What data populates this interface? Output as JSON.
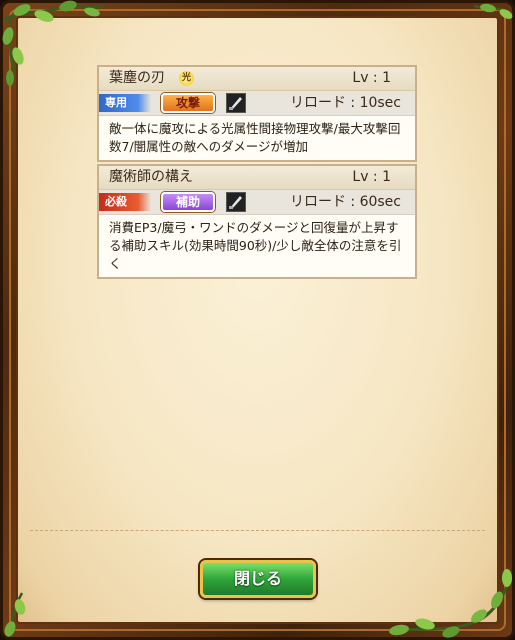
{
  "skills": [
    {
      "name": "葉塵の刃",
      "element_badge": "光",
      "level": "Lv : 1",
      "type_tag": "専用",
      "category": "攻撃",
      "reload": "リロード : 10sec",
      "description": "敵一体に魔攻による光属性間接物理攻撃/最大攻撃回数7/闇属性の敵へのダメージが増加"
    },
    {
      "name": "魔術師の構え",
      "level": "Lv : 1",
      "type_tag": "必殺",
      "category": "補助",
      "reload": "リロード : 60sec",
      "description": "消費EP3/魔弓・ワンドのダメージと回復量が上昇する補助スキル(効果時間90秒)/少し敵全体の注意を引く"
    }
  ],
  "close_button": {
    "label": "閉じる"
  },
  "colors": {
    "frame": "#5c3210",
    "parchment": "#f6e6c3",
    "tag_exclusive": "#2f69c9",
    "tag_special": "#c32d1b",
    "pill_attack": "#e2711a",
    "pill_support": "#8a45d6",
    "close_button": "#2fa63a"
  },
  "icons": [
    "weapon-icon",
    "light-element-icon",
    "vine-decoration"
  ]
}
